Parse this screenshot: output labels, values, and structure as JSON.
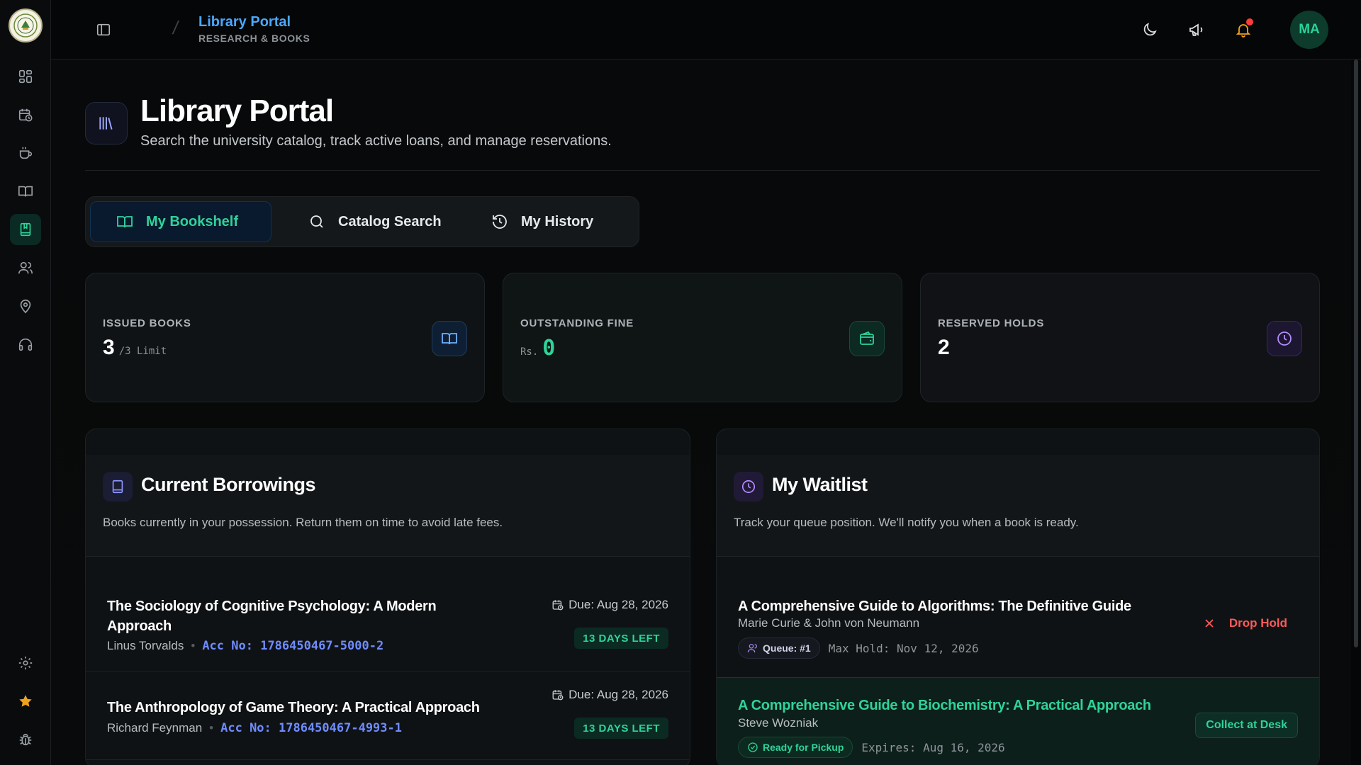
{
  "topbar": {
    "title": "Library Portal",
    "subtitle": "RESEARCH & BOOKS",
    "avatar_initials": "MA"
  },
  "sidebar": {
    "items": [
      {
        "icon": "dashboard-icon"
      },
      {
        "icon": "calendar-clock-icon"
      },
      {
        "icon": "coffee-icon"
      },
      {
        "icon": "book-open-icon"
      },
      {
        "icon": "bookmark-book-icon",
        "active": true
      },
      {
        "icon": "users-icon"
      },
      {
        "icon": "map-pin-icon"
      },
      {
        "icon": "headphones-icon"
      }
    ],
    "bottom": [
      {
        "icon": "settings-icon"
      },
      {
        "icon": "star-icon"
      },
      {
        "icon": "bug-icon"
      }
    ]
  },
  "hero": {
    "title": "Library Portal",
    "subtitle": "Search the university catalog, track active loans, and manage reservations."
  },
  "tabs": [
    {
      "label": "My Bookshelf",
      "active": true
    },
    {
      "label": "Catalog Search"
    },
    {
      "label": "My History"
    }
  ],
  "stats": [
    {
      "label": "ISSUED BOOKS",
      "value": "3",
      "suffix": "/3 Limit"
    },
    {
      "label": "OUTSTANDING FINE",
      "prefix": "Rs.",
      "value": "0"
    },
    {
      "label": "RESERVED HOLDS",
      "value": "2"
    }
  ],
  "borrowings": {
    "title": "Current Borrowings",
    "description": "Books currently in your possession. Return them on time to avoid late fees.",
    "items": [
      {
        "title_line1": "The Sociology of Cognitive Psychology: A Modern",
        "title_line2": "Approach",
        "author": "Linus Torvalds",
        "acc": "Acc No: 1786450467-5000-2",
        "due": "Due: Aug 28, 2026",
        "days_left": "13 DAYS LEFT"
      },
      {
        "title_line1": "The Anthropology of Game Theory: A Practical Approach",
        "author": "Richard Feynman",
        "acc": "Acc No: 1786450467-4993-1",
        "due": "Due: Aug 28, 2026",
        "days_left": "13 DAYS LEFT"
      }
    ]
  },
  "waitlist": {
    "title": "My Waitlist",
    "description": "Track your queue position. We'll notify you when a book is ready.",
    "items": [
      {
        "title": "A Comprehensive Guide to Algorithms: The Definitive Guide",
        "author": "Marie Curie & John von Neumann",
        "queue": "Queue: #1",
        "max_hold": "Max Hold: Nov 12, 2026",
        "action": "Drop Hold"
      },
      {
        "title": "A Comprehensive Guide to Biochemistry: A Practical Approach",
        "author": "Steve Wozniak",
        "status": "Ready for Pickup",
        "expires": "Expires: Aug 16, 2026",
        "action": "Collect at Desk"
      }
    ]
  },
  "colors": {
    "accent_green": "#2fd39a",
    "accent_blue": "#4aa8ff",
    "link_mono": "#6f8cff",
    "danger": "#ff5a5a"
  }
}
